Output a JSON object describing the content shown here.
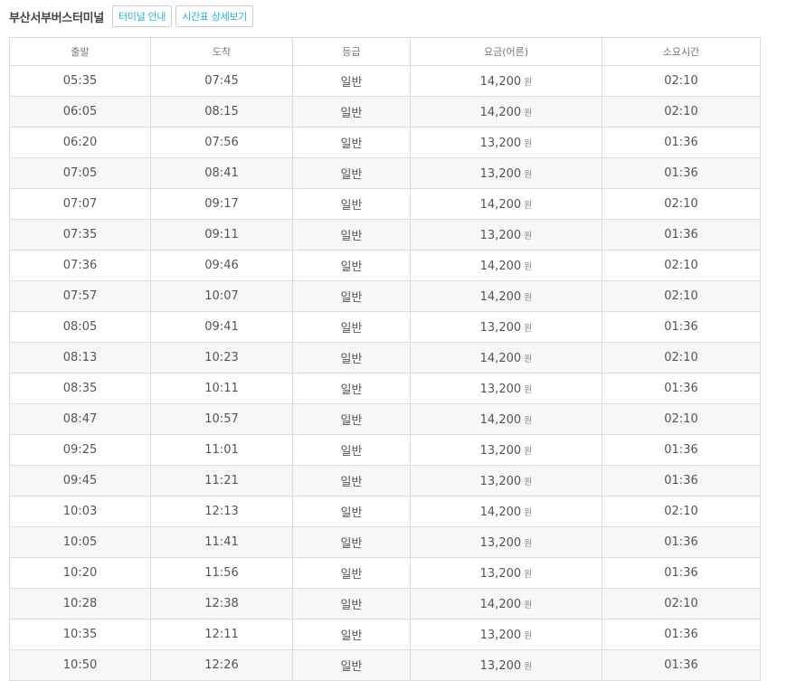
{
  "header": {
    "terminal_name": "부산서부버스터미널",
    "terminal_info_label": "터미널 안내",
    "timetable_detail_label": "시간표 상세보기"
  },
  "table": {
    "columns": [
      "출발",
      "도착",
      "등급",
      "요금(어른)",
      "소요시간"
    ],
    "currency_unit": "원",
    "rows": [
      {
        "depart": "05:35",
        "arrive": "07:45",
        "grade": "일반",
        "fare": "14,200",
        "duration": "02:10"
      },
      {
        "depart": "06:05",
        "arrive": "08:15",
        "grade": "일반",
        "fare": "14,200",
        "duration": "02:10"
      },
      {
        "depart": "06:20",
        "arrive": "07:56",
        "grade": "일반",
        "fare": "13,200",
        "duration": "01:36"
      },
      {
        "depart": "07:05",
        "arrive": "08:41",
        "grade": "일반",
        "fare": "13,200",
        "duration": "01:36"
      },
      {
        "depart": "07:07",
        "arrive": "09:17",
        "grade": "일반",
        "fare": "14,200",
        "duration": "02:10"
      },
      {
        "depart": "07:35",
        "arrive": "09:11",
        "grade": "일반",
        "fare": "13,200",
        "duration": "01:36"
      },
      {
        "depart": "07:36",
        "arrive": "09:46",
        "grade": "일반",
        "fare": "14,200",
        "duration": "02:10"
      },
      {
        "depart": "07:57",
        "arrive": "10:07",
        "grade": "일반",
        "fare": "14,200",
        "duration": "02:10"
      },
      {
        "depart": "08:05",
        "arrive": "09:41",
        "grade": "일반",
        "fare": "13,200",
        "duration": "01:36"
      },
      {
        "depart": "08:13",
        "arrive": "10:23",
        "grade": "일반",
        "fare": "14,200",
        "duration": "02:10"
      },
      {
        "depart": "08:35",
        "arrive": "10:11",
        "grade": "일반",
        "fare": "13,200",
        "duration": "01:36"
      },
      {
        "depart": "08:47",
        "arrive": "10:57",
        "grade": "일반",
        "fare": "14,200",
        "duration": "02:10"
      },
      {
        "depart": "09:25",
        "arrive": "11:01",
        "grade": "일반",
        "fare": "13,200",
        "duration": "01:36"
      },
      {
        "depart": "09:45",
        "arrive": "11:21",
        "grade": "일반",
        "fare": "13,200",
        "duration": "01:36"
      },
      {
        "depart": "10:03",
        "arrive": "12:13",
        "grade": "일반",
        "fare": "14,200",
        "duration": "02:10"
      },
      {
        "depart": "10:05",
        "arrive": "11:41",
        "grade": "일반",
        "fare": "13,200",
        "duration": "01:36"
      },
      {
        "depart": "10:20",
        "arrive": "11:56",
        "grade": "일반",
        "fare": "13,200",
        "duration": "01:36"
      },
      {
        "depart": "10:28",
        "arrive": "12:38",
        "grade": "일반",
        "fare": "14,200",
        "duration": "02:10"
      },
      {
        "depart": "10:35",
        "arrive": "12:11",
        "grade": "일반",
        "fare": "13,200",
        "duration": "01:36"
      },
      {
        "depart": "10:50",
        "arrive": "12:26",
        "grade": "일반",
        "fare": "13,200",
        "duration": "01:36"
      }
    ]
  },
  "colors": {
    "accent": "#28b4cf",
    "border": "#dcdcdc",
    "stripe": "#f7f7f7"
  }
}
